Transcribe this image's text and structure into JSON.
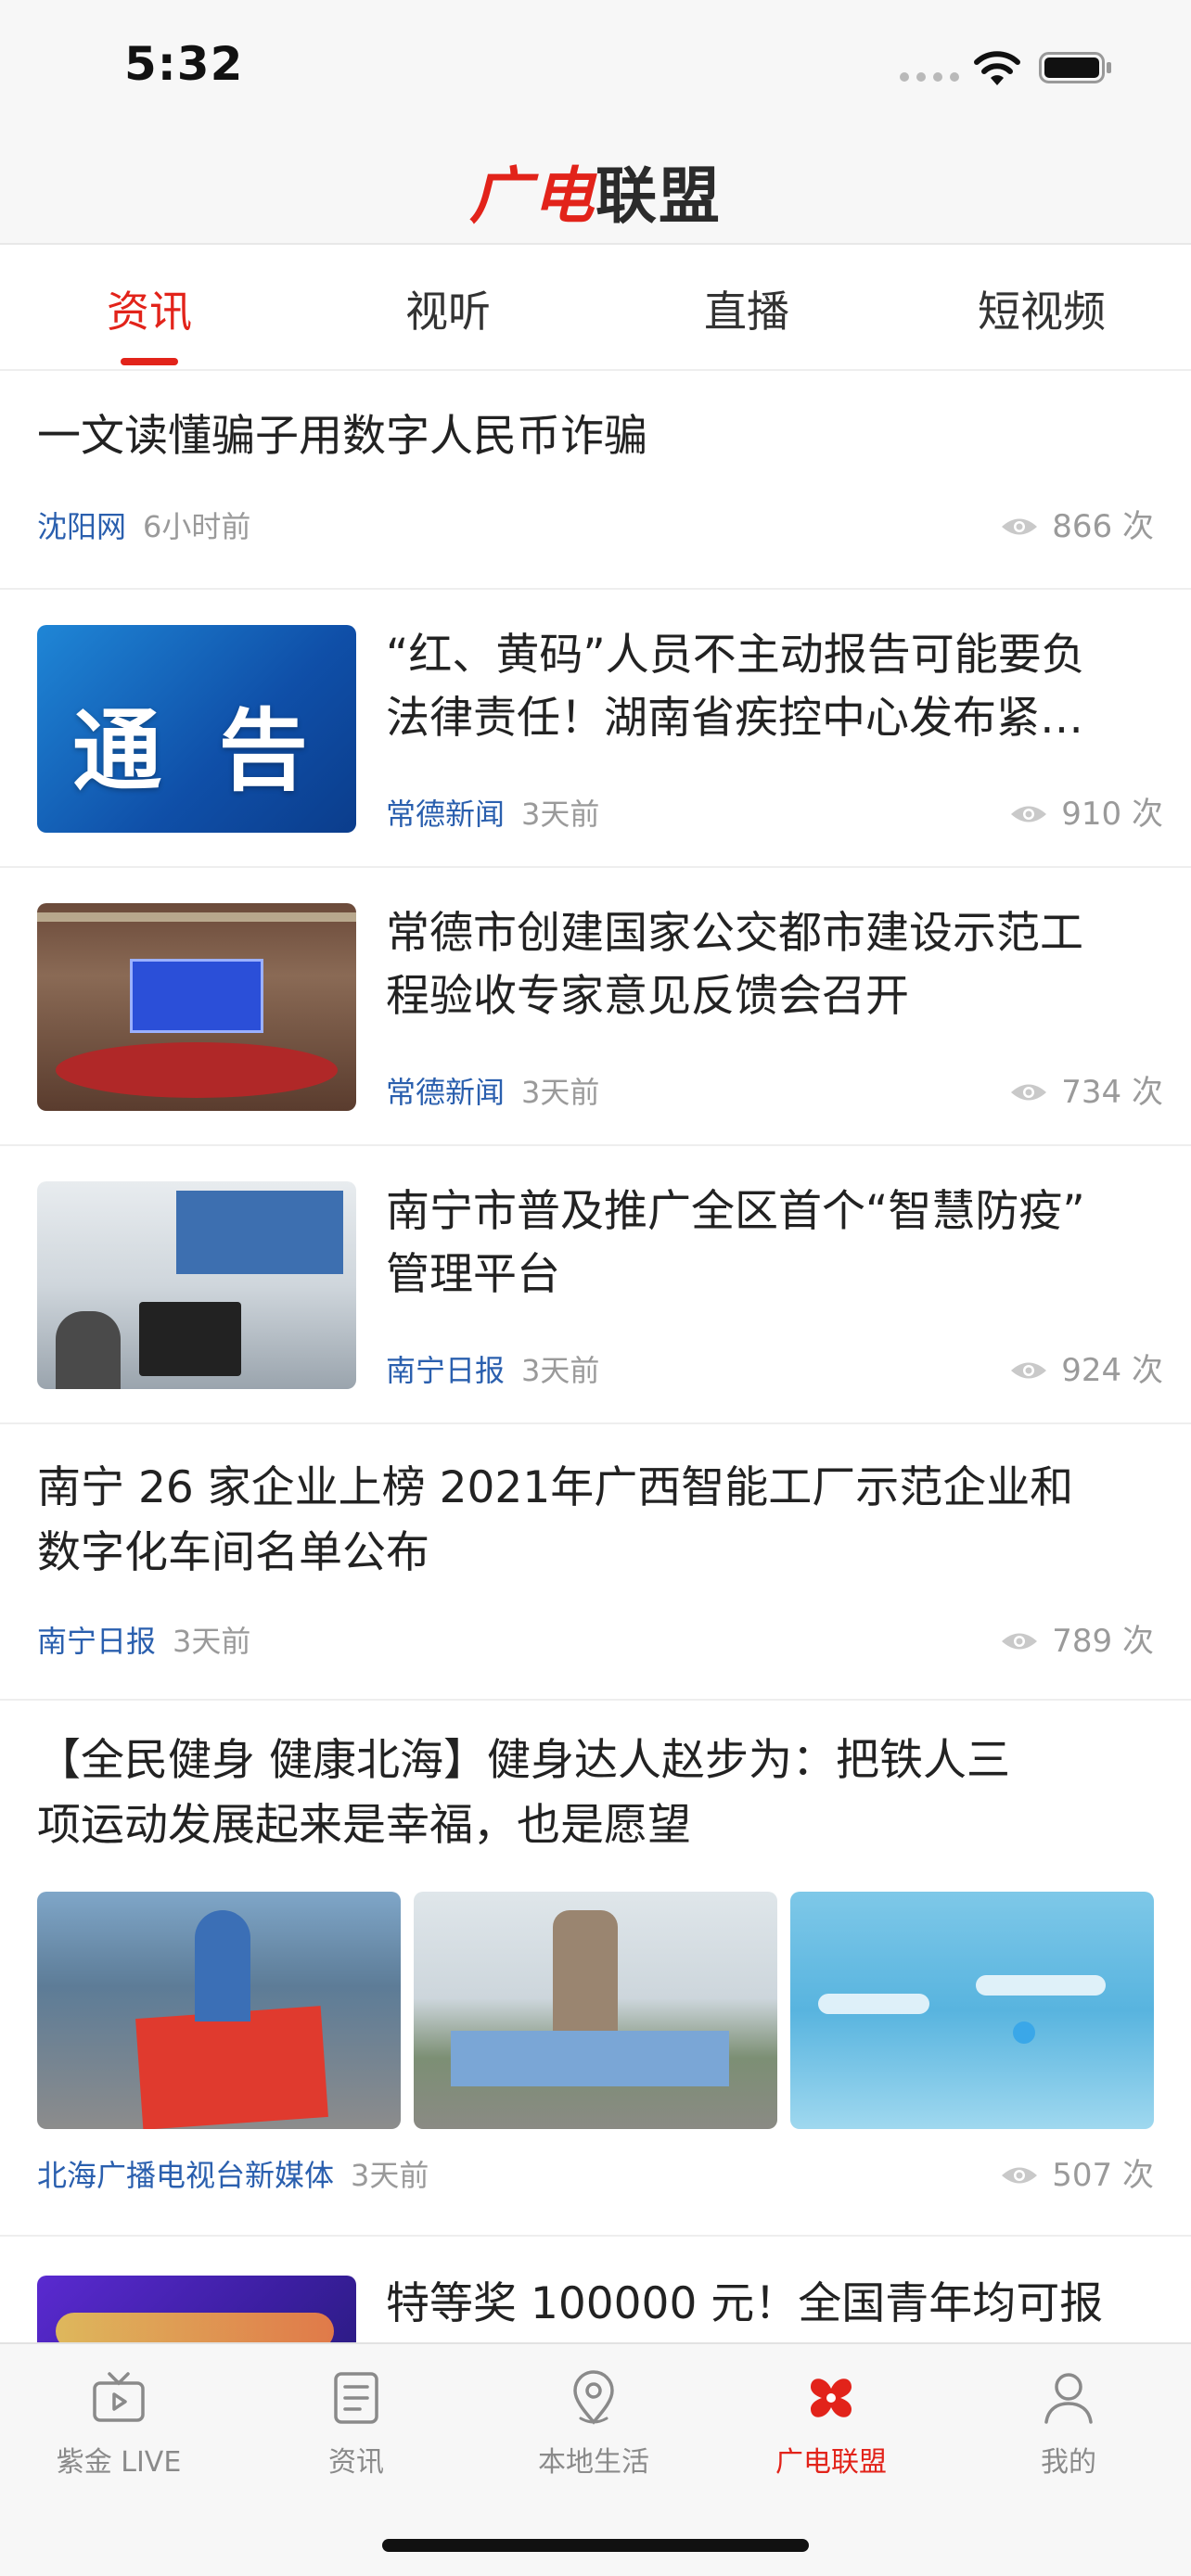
{
  "status_bar": {
    "time": "5:32"
  },
  "header": {
    "logo_part1": "广电",
    "logo_part2": "联盟"
  },
  "tabs": [
    {
      "label": "资讯"
    },
    {
      "label": "视听"
    },
    {
      "label": "直播"
    },
    {
      "label": "短视频"
    }
  ],
  "active_tab": "资讯",
  "feed": [
    {
      "title": "一文读懂骗子用数字人民币诈骗",
      "source": "沈阳网",
      "time": "6小时前",
      "views": "866 次",
      "image": null
    },
    {
      "title_line1": "“红、黄码”人员不主动报告可能要负",
      "title_line2": "法律责任！湖南省疾控中心发布紧…",
      "source": "常德新闻",
      "time": "3天前",
      "views": "910 次",
      "image_text": "通 告"
    },
    {
      "title_line1": "常德市创建国家公交都市建设示范工",
      "title_line2": "程验收专家意见反馈会召开",
      "source": "常德新闻",
      "time": "3天前",
      "views": "734 次",
      "image": "conference-photo"
    },
    {
      "title_line1": "南宁市普及推广全区首个“智慧防疫”",
      "title_line2": "管理平台",
      "source": "南宁日报",
      "time": "3天前",
      "views": "924 次",
      "image": "office-photo"
    },
    {
      "title_line1": "南宁 26 家企业上榜 2021年广西智能工厂示范企业和",
      "title_line2": "数字化车间名单公布",
      "source": "南宁日报",
      "time": "3天前",
      "views": "789 次"
    },
    {
      "title_line1": "【全民健身 健康北海】健身达人赵步为：把铁人三",
      "title_line2": "项运动发展起来是幸福，也是愿望",
      "source": "北海广播电视台新媒体",
      "time": "3天前",
      "views": "507 次",
      "images": [
        "triathlon-flag-photo",
        "cyclists-group-photo",
        "swimmers-photo"
      ]
    },
    {
      "title_line1": "特等奖 100000 元！全国青年均可报",
      "image": "event-banner"
    }
  ],
  "tabbar": [
    {
      "label": "紫金 LIVE",
      "icon": "tv-icon"
    },
    {
      "label": "资讯",
      "icon": "document-list-icon"
    },
    {
      "label": "本地生活",
      "icon": "location-pin-icon"
    },
    {
      "label": "广电联盟",
      "icon": "alliance-logo-icon"
    },
    {
      "label": "我的",
      "icon": "user-icon"
    }
  ],
  "colors": {
    "accent": "#e2231a",
    "source_link": "#2a5fae",
    "meta_gray": "#9a9a9a"
  }
}
